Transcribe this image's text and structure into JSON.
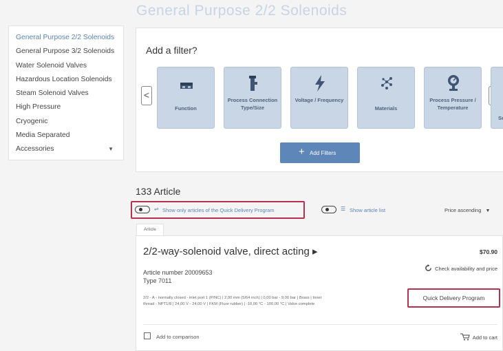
{
  "page_title": "General Purpose 2/2 Solenoids",
  "sidebar": {
    "items": [
      {
        "label": "General Purpose 2/2 Solenoids"
      },
      {
        "label": "General Purpose 3/2 Solenoids"
      },
      {
        "label": "Water Solenoid Valves"
      },
      {
        "label": "Hazardous Location Solenoids"
      },
      {
        "label": "Steam Solenoid Valves"
      },
      {
        "label": "High Pressure"
      },
      {
        "label": "Cryogenic"
      },
      {
        "label": "Media Separated"
      },
      {
        "label": "Accessories"
      }
    ],
    "dropdown_glyph": "▼"
  },
  "filters": {
    "title": "Add a filter?",
    "prev_glyph": "<",
    "next_glyph": ">",
    "tiles": [
      {
        "label": "Function",
        "icon": "function-icon"
      },
      {
        "label": "Process Connection Type/Size",
        "icon": "connection-icon"
      },
      {
        "label": "Voltage / Frequency",
        "icon": "lightning-icon"
      },
      {
        "label": "Materials",
        "icon": "materials-icon"
      },
      {
        "label": "Process Pressure / Temperature",
        "icon": "gauge-icon"
      },
      {
        "label": "Se",
        "icon": "partial-icon"
      }
    ],
    "add_button_plus": "+",
    "add_button": "Add Filters"
  },
  "results": {
    "count": "133 Article",
    "quick_delivery_toggle_label": "Show only articles of the Quick Delivery Program",
    "article_list_toggle_label": "Show article list",
    "sort": "Price ascending",
    "sort_glyph": "▼"
  },
  "article": {
    "tab_label": "Article",
    "title": "2/2-way-solenoid valve, direct acting ▸",
    "article_number": "Article number 20009653",
    "type": "Type 7011",
    "specs": "2/2 - A - normally closed - inlet port 1 (P/NC) | 2,00 mm (5/64 inch) | 0,00 bar - 9,00 bar | Brass | Inner thread - NPT1/8 | 24,00 V - 24,00 V | FKM (Fluor rubber) | -10,00 °C - 100,00 °C | Valve complete",
    "price": "$70.90",
    "availability": "Check availability and price",
    "quick_delivery": "Quick Delivery Program",
    "compare": "Add to comparison",
    "add_to_cart": "Add to cart"
  },
  "colors": {
    "accent": "#5f86b8",
    "tile_bg": "#c8d6e6",
    "highlight_frame": "#b5304f"
  }
}
